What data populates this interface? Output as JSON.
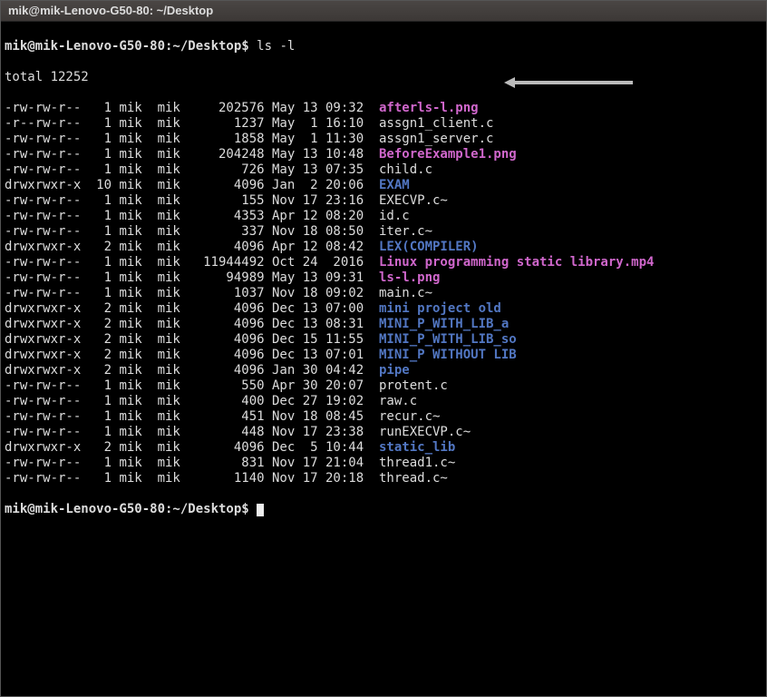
{
  "title": "mik@mik-Lenovo-G50-80: ~/Desktop",
  "prompt": "mik@mik-Lenovo-G50-80:~/Desktop$ ",
  "command": "ls -l",
  "total_line": "total 12252",
  "file_colors": {
    "default": "name-default",
    "image": "name-image",
    "dir": "name-dir"
  },
  "files": [
    {
      "perms": "-rw-rw-r--",
      "links": "1",
      "owner": "mik",
      "group": "mik",
      "size": "202576",
      "date": "May 13 09:32",
      "name": "afterls-l.png",
      "kind": "image"
    },
    {
      "perms": "-r--rw-r--",
      "links": "1",
      "owner": "mik",
      "group": "mik",
      "size": "1237",
      "date": "May  1 16:10",
      "name": "assgn1_client.c",
      "kind": "default"
    },
    {
      "perms": "-rw-rw-r--",
      "links": "1",
      "owner": "mik",
      "group": "mik",
      "size": "1858",
      "date": "May  1 11:30",
      "name": "assgn1_server.c",
      "kind": "default"
    },
    {
      "perms": "-rw-rw-r--",
      "links": "1",
      "owner": "mik",
      "group": "mik",
      "size": "204248",
      "date": "May 13 10:48",
      "name": "BeforeExample1.png",
      "kind": "image"
    },
    {
      "perms": "-rw-rw-r--",
      "links": "1",
      "owner": "mik",
      "group": "mik",
      "size": "726",
      "date": "May 13 07:35",
      "name": "child.c",
      "kind": "default"
    },
    {
      "perms": "drwxrwxr-x",
      "links": "10",
      "owner": "mik",
      "group": "mik",
      "size": "4096",
      "date": "Jan  2 20:06",
      "name": "EXAM",
      "kind": "dir"
    },
    {
      "perms": "-rw-rw-r--",
      "links": "1",
      "owner": "mik",
      "group": "mik",
      "size": "155",
      "date": "Nov 17 23:16",
      "name": "EXECVP.c~",
      "kind": "default"
    },
    {
      "perms": "-rw-rw-r--",
      "links": "1",
      "owner": "mik",
      "group": "mik",
      "size": "4353",
      "date": "Apr 12 08:20",
      "name": "id.c",
      "kind": "default"
    },
    {
      "perms": "-rw-rw-r--",
      "links": "1",
      "owner": "mik",
      "group": "mik",
      "size": "337",
      "date": "Nov 18 08:50",
      "name": "iter.c~",
      "kind": "default"
    },
    {
      "perms": "drwxrwxr-x",
      "links": "2",
      "owner": "mik",
      "group": "mik",
      "size": "4096",
      "date": "Apr 12 08:42",
      "name": "LEX(COMPILER)",
      "kind": "dir"
    },
    {
      "perms": "-rw-rw-r--",
      "links": "1",
      "owner": "mik",
      "group": "mik",
      "size": "11944492",
      "date": "Oct 24  2016",
      "name": "Linux programming static library.mp4",
      "kind": "image"
    },
    {
      "perms": "-rw-rw-r--",
      "links": "1",
      "owner": "mik",
      "group": "mik",
      "size": "94989",
      "date": "May 13 09:31",
      "name": "ls-l.png",
      "kind": "image"
    },
    {
      "perms": "-rw-rw-r--",
      "links": "1",
      "owner": "mik",
      "group": "mik",
      "size": "1037",
      "date": "Nov 18 09:02",
      "name": "main.c~",
      "kind": "default"
    },
    {
      "perms": "drwxrwxr-x",
      "links": "2",
      "owner": "mik",
      "group": "mik",
      "size": "4096",
      "date": "Dec 13 07:00",
      "name": "mini project old",
      "kind": "dir"
    },
    {
      "perms": "drwxrwxr-x",
      "links": "2",
      "owner": "mik",
      "group": "mik",
      "size": "4096",
      "date": "Dec 13 08:31",
      "name": "MINI_P_WITH_LIB_a",
      "kind": "dir"
    },
    {
      "perms": "drwxrwxr-x",
      "links": "2",
      "owner": "mik",
      "group": "mik",
      "size": "4096",
      "date": "Dec 15 11:55",
      "name": "MINI_P_WITH_LIB_so",
      "kind": "dir"
    },
    {
      "perms": "drwxrwxr-x",
      "links": "2",
      "owner": "mik",
      "group": "mik",
      "size": "4096",
      "date": "Dec 13 07:01",
      "name": "MINI_P WITHOUT LIB",
      "kind": "dir"
    },
    {
      "perms": "drwxrwxr-x",
      "links": "2",
      "owner": "mik",
      "group": "mik",
      "size": "4096",
      "date": "Jan 30 04:42",
      "name": "pipe",
      "kind": "dir"
    },
    {
      "perms": "-rw-rw-r--",
      "links": "1",
      "owner": "mik",
      "group": "mik",
      "size": "550",
      "date": "Apr 30 20:07",
      "name": "protent.c",
      "kind": "default"
    },
    {
      "perms": "-rw-rw-r--",
      "links": "1",
      "owner": "mik",
      "group": "mik",
      "size": "400",
      "date": "Dec 27 19:02",
      "name": "raw.c",
      "kind": "default"
    },
    {
      "perms": "-rw-rw-r--",
      "links": "1",
      "owner": "mik",
      "group": "mik",
      "size": "451",
      "date": "Nov 18 08:45",
      "name": "recur.c~",
      "kind": "default"
    },
    {
      "perms": "-rw-rw-r--",
      "links": "1",
      "owner": "mik",
      "group": "mik",
      "size": "448",
      "date": "Nov 17 23:38",
      "name": "runEXECVP.c~",
      "kind": "default"
    },
    {
      "perms": "drwxrwxr-x",
      "links": "2",
      "owner": "mik",
      "group": "mik",
      "size": "4096",
      "date": "Dec  5 10:44",
      "name": "static_lib",
      "kind": "dir"
    },
    {
      "perms": "-rw-rw-r--",
      "links": "1",
      "owner": "mik",
      "group": "mik",
      "size": "831",
      "date": "Nov 17 21:04",
      "name": "thread1.c~",
      "kind": "default"
    },
    {
      "perms": "-rw-rw-r--",
      "links": "1",
      "owner": "mik",
      "group": "mik",
      "size": "1140",
      "date": "Nov 17 20:18",
      "name": "thread.c~",
      "kind": "default"
    }
  ]
}
